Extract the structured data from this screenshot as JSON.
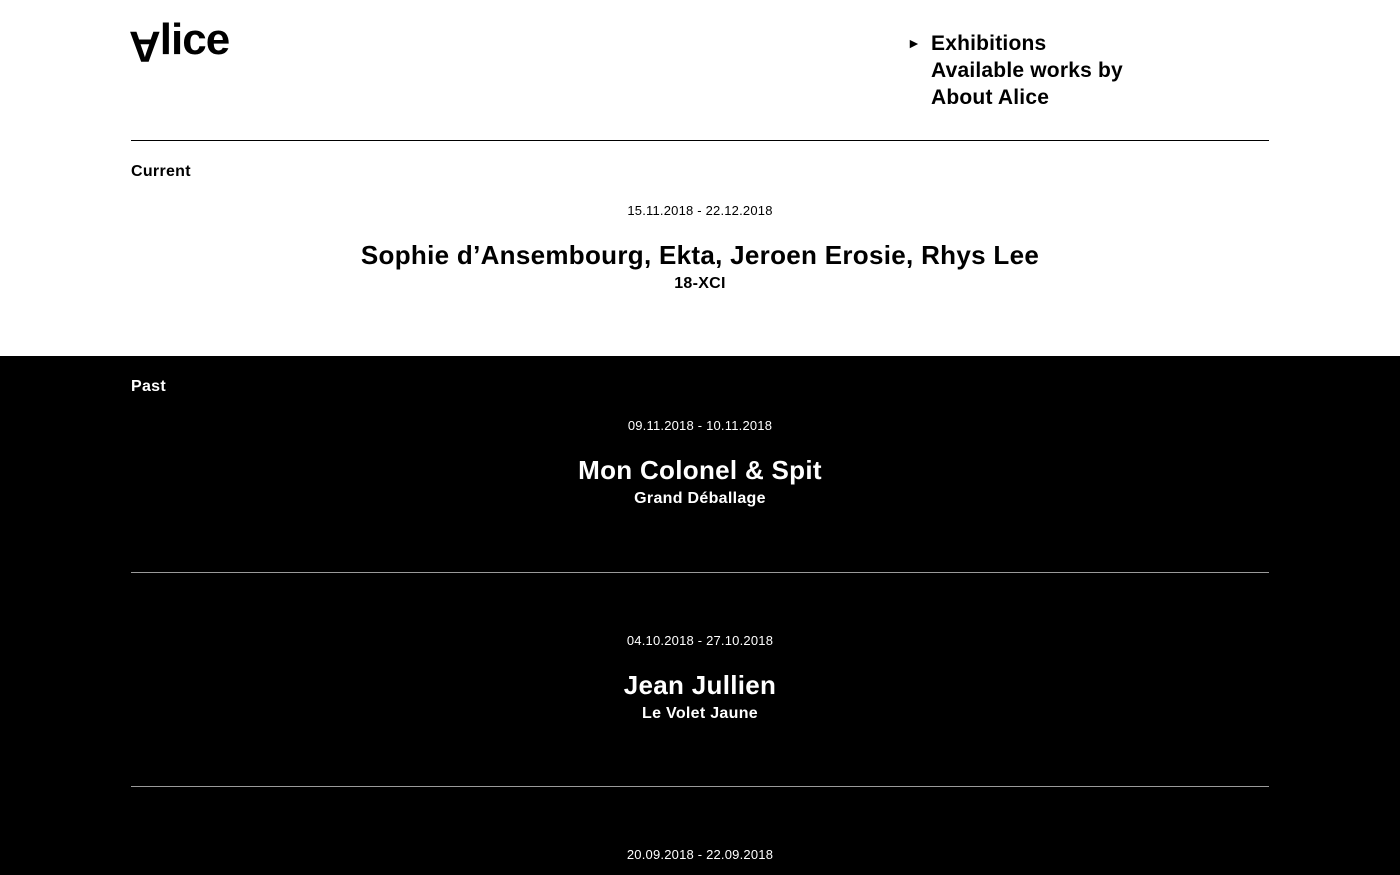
{
  "site": {
    "logo_flipped": "A",
    "logo_rest": "lice"
  },
  "nav": {
    "active_marker": "►",
    "items": [
      {
        "label": "Exhibitions",
        "active": true
      },
      {
        "label": "Available works by"
      },
      {
        "label": "About Alice"
      }
    ]
  },
  "current": {
    "label": "Current",
    "exhibitions": [
      {
        "dates": "15.11.2018 - 22.12.2018",
        "artists": "Sophie d’Ansembourg, Ekta, Jeroen Erosie, Rhys Lee",
        "title": "18-XCI"
      }
    ]
  },
  "past": {
    "label": "Past",
    "exhibitions": [
      {
        "dates": "09.11.2018 - 10.11.2018",
        "artists": "Mon Colonel & Spit",
        "title": "Grand Déballage"
      },
      {
        "dates": "04.10.2018 - 27.10.2018",
        "artists": "Jean Jullien",
        "title": "Le Volet Jaune"
      },
      {
        "dates": "20.09.2018 - 22.09.2018"
      }
    ]
  },
  "colors": {
    "background": "#ffffff",
    "past_background": "#000000",
    "text_dark": "#000000",
    "text_light": "#ffffff",
    "divider_light": "#9a9a9a"
  }
}
